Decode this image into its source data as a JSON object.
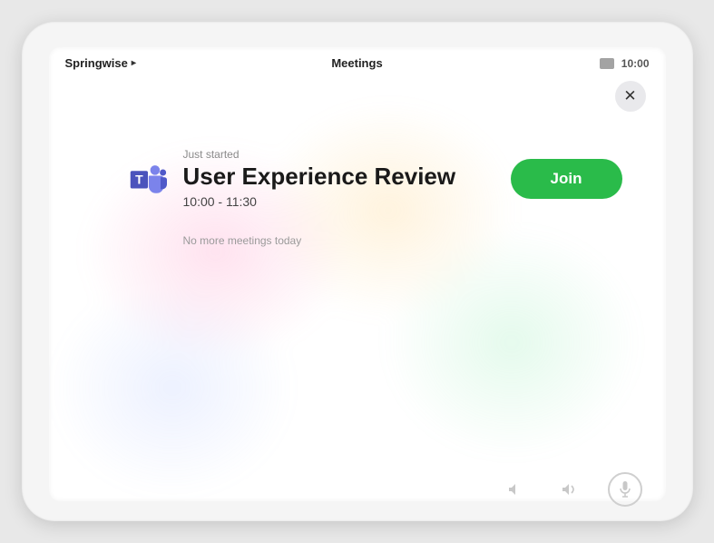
{
  "topbar": {
    "room_name": "Springwise",
    "page_title": "Meetings",
    "time": "10:00"
  },
  "close": {
    "icon_label": "close"
  },
  "meeting": {
    "status": "Just started",
    "title": "User Experience Review",
    "time_range": "10:00 - 11:30",
    "join_label": "Join",
    "platform_icon": "teams"
  },
  "footer": {
    "no_more": "No more meetings today"
  },
  "colors": {
    "join_button": "#2abb4a",
    "teams_purple": "#5059c9"
  }
}
